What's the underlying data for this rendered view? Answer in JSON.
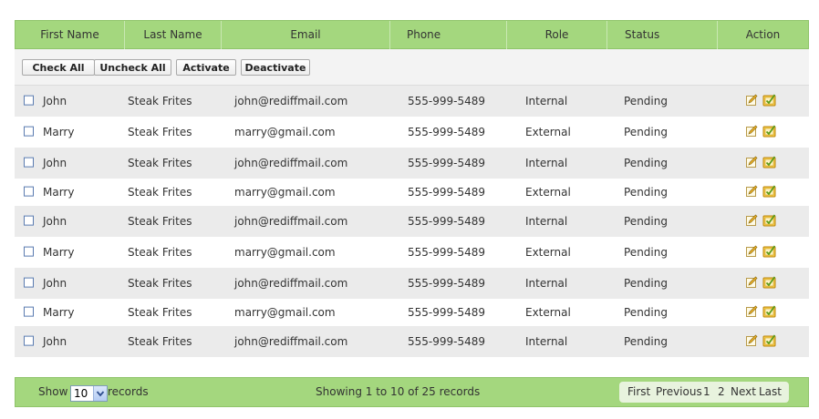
{
  "columns": {
    "first_name": "First Name",
    "last_name": "Last Name",
    "email": "Email",
    "phone": "Phone",
    "role": "Role",
    "status": "Status",
    "action": "Action"
  },
  "toolbar": {
    "check_all": "Check All",
    "uncheck_all": "Uncheck All",
    "activate": "Activate",
    "deactivate": "Deactivate"
  },
  "rows": [
    {
      "first": "John",
      "last": "Steak Frites",
      "email": "john@rediffmail.com",
      "phone": "555-999-5489",
      "role": "Internal",
      "status": "Pending"
    },
    {
      "first": "Marry",
      "last": "Steak Frites",
      "email": "marry@gmail.com",
      "phone": "555-999-5489",
      "role": "External",
      "status": "Pending"
    },
    {
      "first": "John",
      "last": "Steak Frites",
      "email": "john@rediffmail.com",
      "phone": "555-999-5489",
      "role": "Internal",
      "status": "Pending"
    },
    {
      "first": "Marry",
      "last": "Steak Frites",
      "email": "marry@gmail.com",
      "phone": "555-999-5489",
      "role": "External",
      "status": "Pending"
    },
    {
      "first": "John",
      "last": "Steak Frites",
      "email": "john@rediffmail.com",
      "phone": "555-999-5489",
      "role": "Internal",
      "status": "Pending"
    },
    {
      "first": "Marry",
      "last": "Steak Frites",
      "email": "marry@gmail.com",
      "phone": "555-999-5489",
      "role": "External",
      "status": "Pending"
    },
    {
      "first": "John",
      "last": "Steak Frites",
      "email": "john@rediffmail.com",
      "phone": "555-999-5489",
      "role": "Internal",
      "status": "Pending"
    },
    {
      "first": "Marry",
      "last": "Steak Frites",
      "email": "marry@gmail.com",
      "phone": "555-999-5489",
      "role": "External",
      "status": "Pending"
    },
    {
      "first": "John",
      "last": "Steak Frites",
      "email": "john@rediffmail.com",
      "phone": "555-999-5489",
      "role": "Internal",
      "status": "Pending"
    }
  ],
  "row_icons": [
    "edit-icon",
    "approve-icon"
  ],
  "footer": {
    "show_label": "Show",
    "page_size": "10",
    "records_label": "records",
    "showing_text": "Showing 1 to 10 of 25  records",
    "pager": {
      "first": "First",
      "previous": "Previous",
      "page1": "1",
      "page2": "2",
      "next": "Next",
      "last": "Last"
    }
  },
  "colors": {
    "header_green": "#a4d77e",
    "row_alt": "#ebebeb",
    "toolbar_bg": "#f3f3f3",
    "pager_bg": "#e8f3de"
  }
}
